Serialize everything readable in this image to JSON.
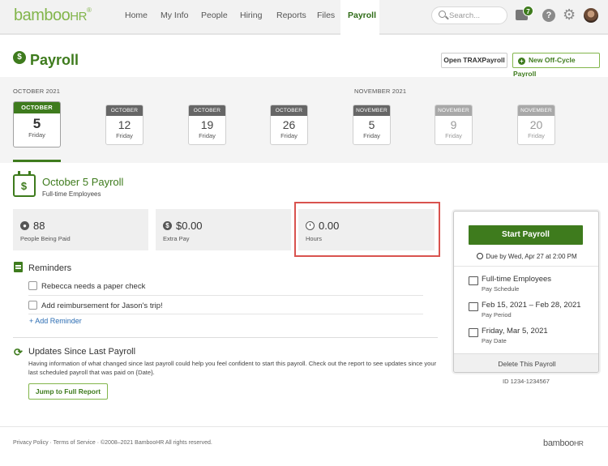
{
  "nav": {
    "logo_main": "bamboo",
    "logo_hr": "HR",
    "logo_reg": "®",
    "items": [
      "Home",
      "My Info",
      "People",
      "Hiring",
      "Reports",
      "Files",
      "Payroll"
    ],
    "search_placeholder": "Search...",
    "inbox_badge": "7",
    "help_glyph": "?",
    "gear_glyph": "⚙"
  },
  "header": {
    "title": "Payroll",
    "dollar_glyph": "$",
    "open_trax": "Open TRAXPayroll",
    "new_off_cycle": "New Off-Cycle Payroll",
    "plus_glyph": "+"
  },
  "calendar": {
    "month_labels": [
      "OCTOBER 2021",
      "NOVEMBER 2021"
    ],
    "dates": [
      {
        "month": "OCTOBER",
        "day": "5",
        "dow": "Friday",
        "state": "selected"
      },
      {
        "month": "OCTOBER",
        "day": "12",
        "dow": "Friday",
        "state": "normal"
      },
      {
        "month": "OCTOBER",
        "day": "19",
        "dow": "Friday",
        "state": "normal"
      },
      {
        "month": "OCTOBER",
        "day": "26",
        "dow": "Friday",
        "state": "normal"
      },
      {
        "month": "NOVEMBER",
        "day": "5",
        "dow": "Friday",
        "state": "normal"
      },
      {
        "month": "NOVEMBER",
        "day": "9",
        "dow": "Friday",
        "state": "faded"
      },
      {
        "month": "NOVEMBER",
        "day": "20",
        "dow": "Friday",
        "state": "faded"
      }
    ]
  },
  "payroll": {
    "icon_glyph": "$",
    "title": "October 5 Payroll",
    "subtitle": "Full-time Employees",
    "stats": [
      {
        "value": "88",
        "label": "People Being Paid",
        "icon_glyph": "●"
      },
      {
        "value": "$0.00",
        "label": "Extra Pay",
        "icon_glyph": "$"
      },
      {
        "value": "0.00",
        "label": "Hours",
        "icon_glyph": ""
      }
    ]
  },
  "reminders": {
    "title": "Reminders",
    "items": [
      "Rebecca needs a paper check",
      "Add reimbursement for Jason's trip!"
    ],
    "add_link": "+ Add Reminder"
  },
  "updates": {
    "icon_glyph": "⟳",
    "title": "Updates Since Last Payroll",
    "description": "Having information of what changed since last payroll could help you feel confident to start this payroll. Check out the report to see updates since your last scheduled payroll that was paid on {Date}.",
    "button": "Jump to Full Report"
  },
  "card": {
    "start_button": "Start Payroll",
    "due_text": "Due by Wed, Apr 27 at 2:00 PM",
    "info": [
      {
        "title": "Full-time Employees",
        "sub": "Pay Schedule"
      },
      {
        "title": "Feb 15, 2021 – Feb 28, 2021",
        "sub": "Pay Period"
      },
      {
        "title": "Friday, Mar 5, 2021",
        "sub": "Pay Date"
      }
    ],
    "delete": "Delete This Payroll",
    "id_text": "ID 1234-1234567"
  },
  "footer": {
    "text": "Privacy Policy · Terms of Service · ©2008–2021 BambooHR All rights reserved.",
    "logo_main": "bamboo",
    "logo_hr": "HR"
  },
  "colors": {
    "brand_green": "#3e7b1d",
    "logo_green": "#82b54b",
    "highlight_red": "#d9534f",
    "link_blue": "#2c6db3"
  }
}
